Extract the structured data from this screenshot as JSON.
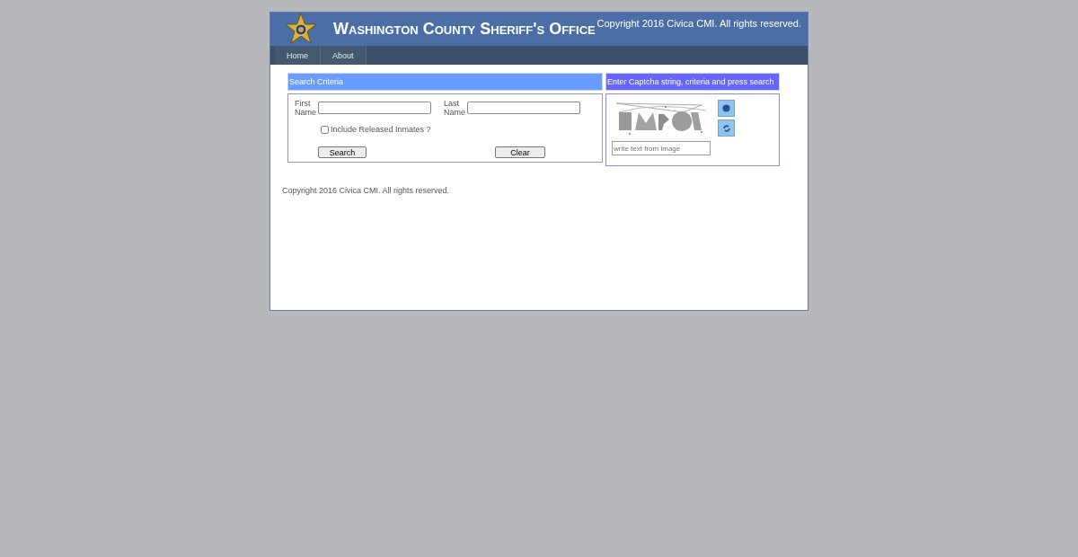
{
  "header": {
    "title": "Washington County Sheriff's Office",
    "copyright": "Copyright 2016 Civica CMI. All rights reserved."
  },
  "nav": [
    {
      "label": "Home"
    },
    {
      "label": "About"
    }
  ],
  "search": {
    "heading": "Search Criteria",
    "first_name_label": "First Name",
    "last_name_label": "Last Name",
    "include_released": {
      "label": "Include Released Inmates ?",
      "checked": false
    },
    "search_button": "Search",
    "clear_button": "Clear"
  },
  "captcha": {
    "heading": "Enter Captcha string, criteria and press search",
    "placeholder": "write text from image"
  },
  "footer": "Copyright 2016 Civica CMI. All rights reserved."
}
